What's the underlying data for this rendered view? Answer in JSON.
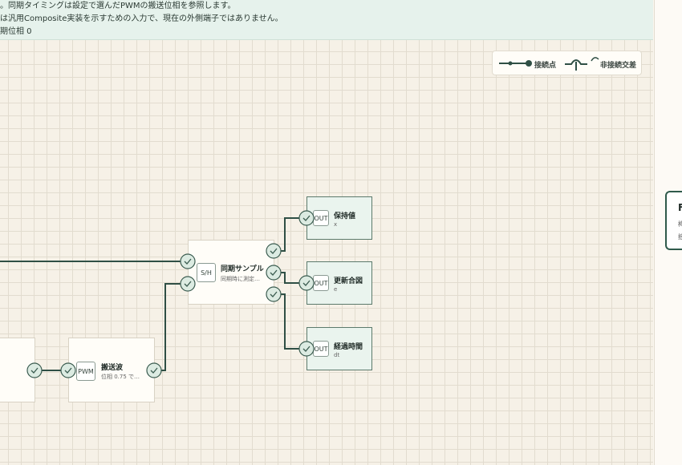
{
  "info": {
    "line1": "。同期タイミングは設定で選んだPWMの搬送位相を参照します。",
    "line2": "は汎用Composite実装を示すための入力で、現在の外側端子ではありません。",
    "line3": "期位相 0"
  },
  "legend": {
    "connected_label": "接続点",
    "crossing_label": "非接続交差"
  },
  "nodes": {
    "sh": {
      "badge": "S/H",
      "title": "同期サンプル",
      "subtitle": "同期時に測定…"
    },
    "pwm": {
      "badge": "PWM",
      "title": "搬送波",
      "subtitle": "位相 0.75 で…"
    },
    "out_hold": {
      "badge": "OUT",
      "title": "保持値",
      "subtitle": "x"
    },
    "out_update": {
      "badge": "OUT",
      "title": "更新合図",
      "subtitle": "e"
    },
    "out_elapsed": {
      "badge": "OUT",
      "title": "経過時間",
      "subtitle": "dt"
    }
  },
  "side_card": {
    "title": "F",
    "line1": "梅",
    "line2": "揺"
  },
  "colors": {
    "wire": "#2f4f45",
    "port_fill": "#dcebe2",
    "port_stroke": "#3b5c50",
    "output_fill": "#eaf4ee"
  },
  "icons": {
    "port": "check-circle-icon"
  }
}
